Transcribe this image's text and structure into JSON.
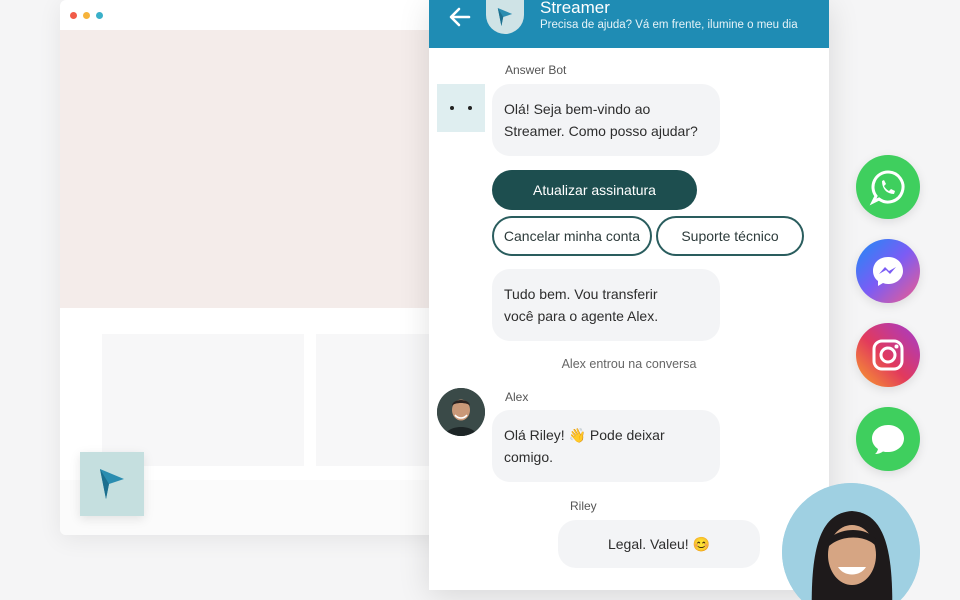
{
  "window": {
    "traffic_lights": [
      "#f15b48",
      "#f6b33b",
      "#3ab0c9"
    ]
  },
  "chat": {
    "header": {
      "title": "Streamer",
      "subtitle": "Precisa de ajuda? Vá em frente, ilumine o meu dia",
      "background": "#1f8cb4"
    },
    "messages": {
      "bot_name": "Answer Bot",
      "bot_greeting_line1": "Olá! Seja bem-vindo ao",
      "bot_greeting_line2": "Streamer. Como posso ajudar?",
      "bot_transfer_line1": "Tudo bem. Vou transferir",
      "bot_transfer_line2": "você para o agente Alex.",
      "system_joined": "Alex entrou na conversa",
      "agent_name": "Alex",
      "agent_msg_line1_a": "Olá Riley!",
      "agent_msg_emoji": "👋",
      "agent_msg_line1_b": "Pode deixar",
      "agent_msg_line2": "comigo.",
      "customer_name": "Riley",
      "customer_msg": "Legal. Valeu!",
      "customer_emoji": "😊"
    },
    "quick_replies": {
      "update_subscription": "Atualizar assinatura",
      "cancel_account": "Cancelar minha conta",
      "tech_support": "Suporte técnico"
    }
  },
  "social_channels": [
    {
      "icon": "whatsapp-icon",
      "color": "#3fcf5e"
    },
    {
      "icon": "messenger-icon",
      "color": "#7b5cf5"
    },
    {
      "icon": "instagram-icon",
      "color": "#d6307a"
    },
    {
      "icon": "imessage-icon",
      "color": "#3fcf5e"
    }
  ]
}
